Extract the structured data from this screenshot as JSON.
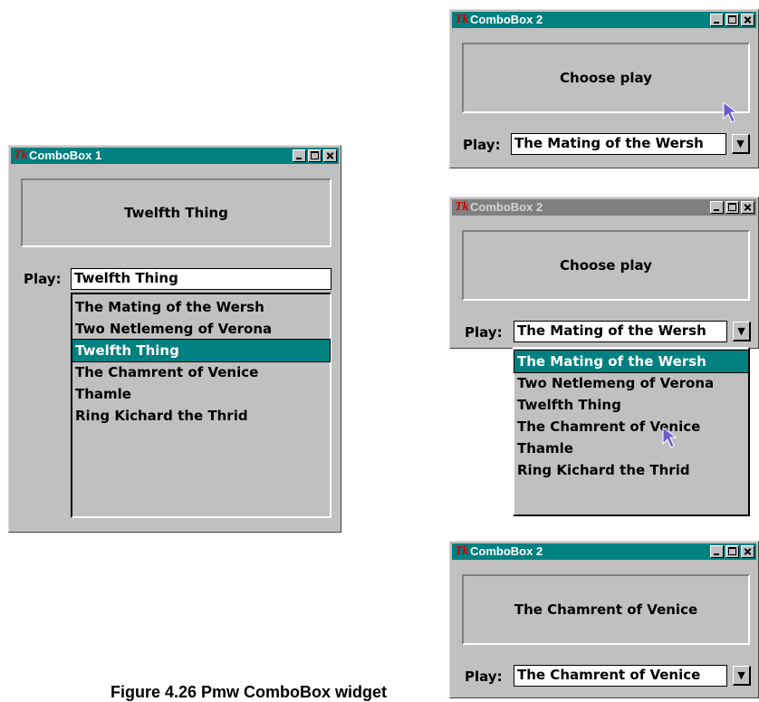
{
  "windows": {
    "cb1": {
      "title": "ComboBox 1",
      "label": "Twelfth Thing",
      "play_label": "Play:",
      "entry_value": "Twelfth Thing"
    },
    "cb2a": {
      "title": "ComboBox 2",
      "label": "Choose play",
      "play_label": "Play:",
      "entry_value": "The Mating of the Wersh"
    },
    "cb2b": {
      "title": "ComboBox 2",
      "label": "Choose play",
      "play_label": "Play:",
      "entry_value": "The Mating of the Wersh"
    },
    "cb2c": {
      "title": "ComboBox 2",
      "label": "The Chamrent of Venice",
      "play_label": "Play:",
      "entry_value": "The Chamrent of Venice"
    }
  },
  "plays": [
    "The Mating of the Wersh",
    "Two Netlemeng of Verona",
    "Twelfth Thing",
    "The Chamrent of Venice",
    "Thamle",
    "Ring Kichard the Thrid"
  ],
  "icons": {
    "app": "Tk",
    "dropdown": "▼"
  },
  "caption": "Figure 4.26  Pmw ComboBox widget",
  "colors": {
    "titlebar_active": "#008080",
    "titlebar_inactive": "#808080",
    "selection": "#008080",
    "window_bg": "#c0c0c0"
  }
}
